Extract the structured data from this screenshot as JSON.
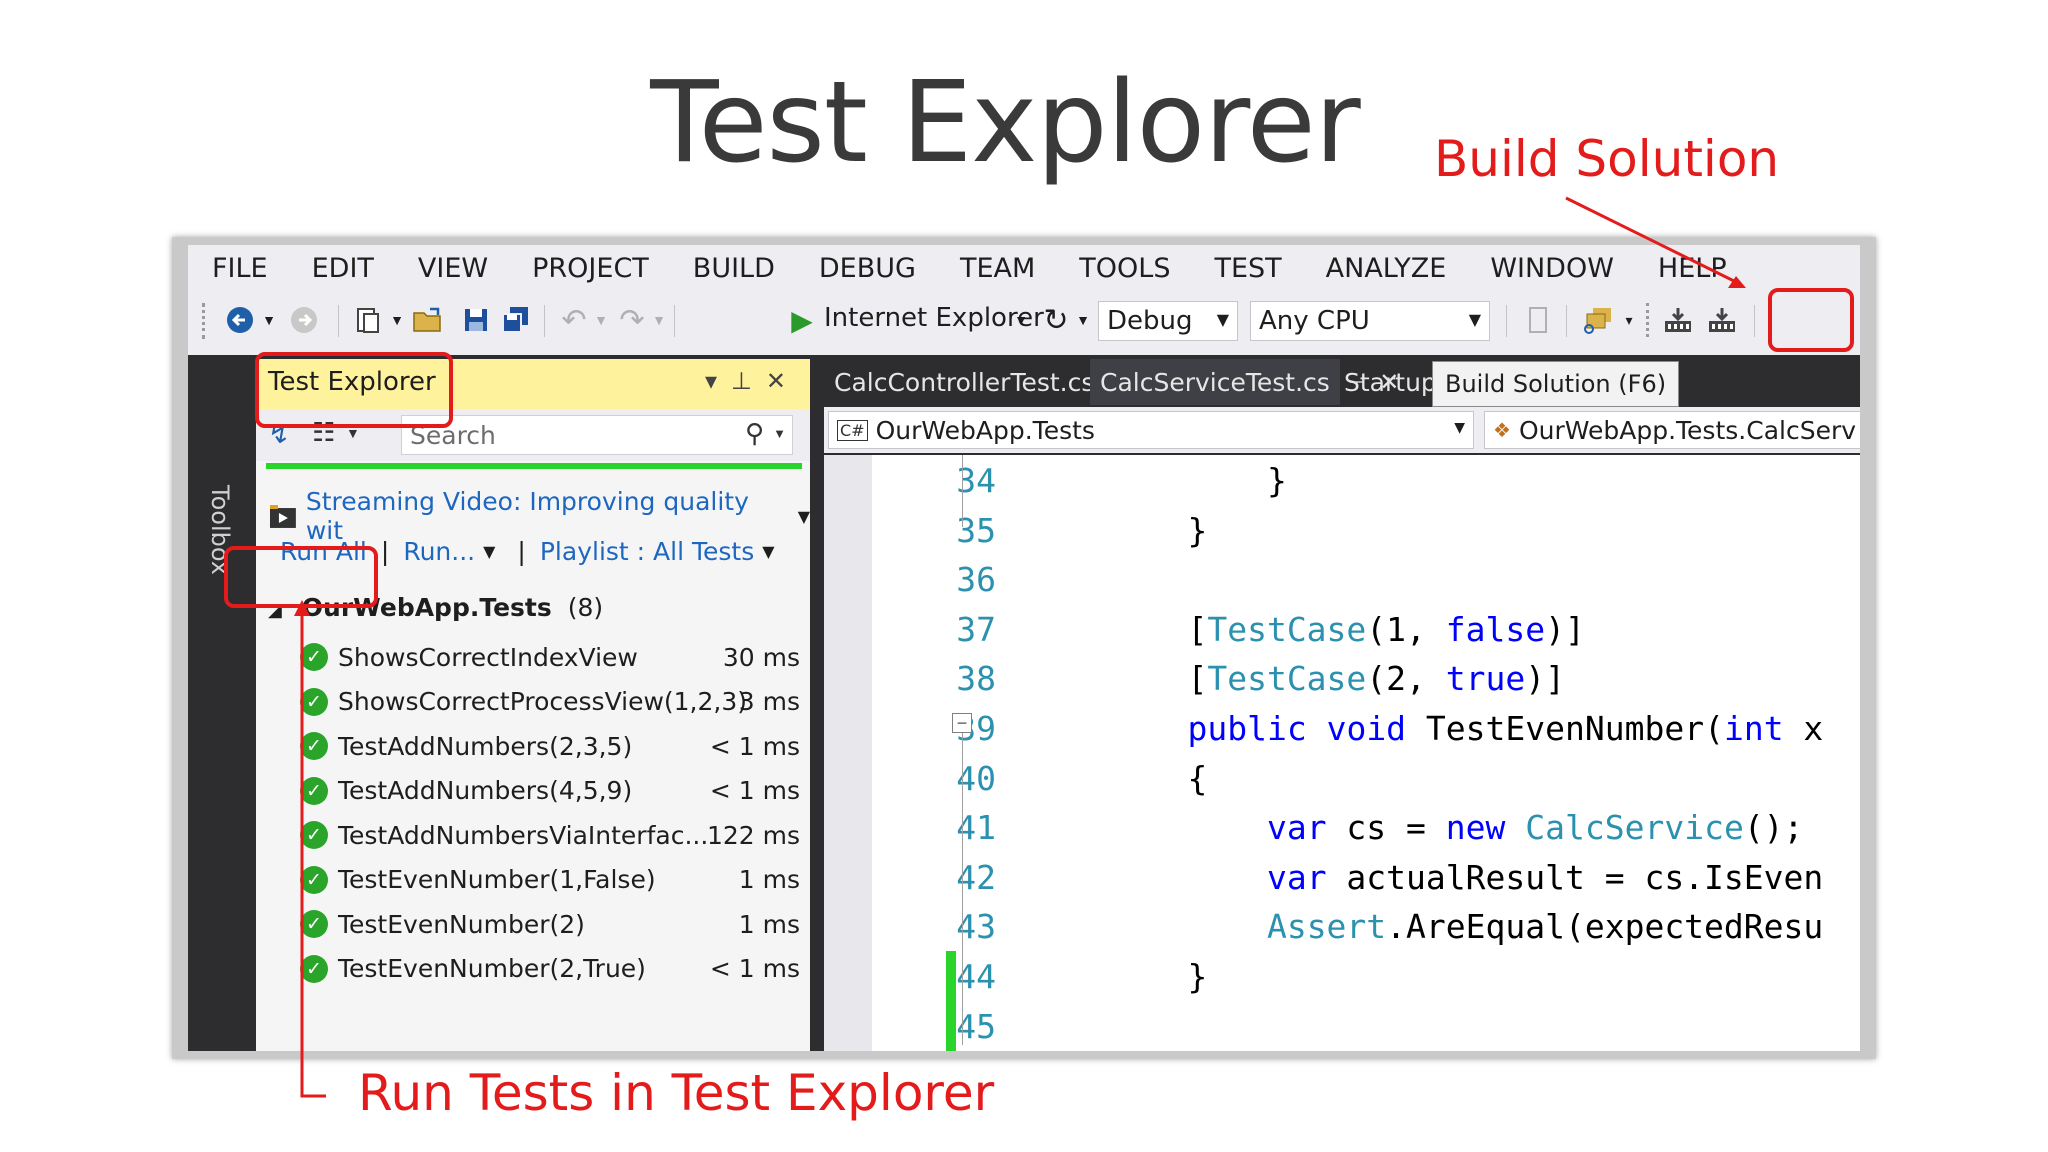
{
  "slide": {
    "title": "Test Explorer",
    "callout_build": "Build Solution",
    "callout_run": "Run Tests in Test Explorer"
  },
  "menu": [
    "FILE",
    "EDIT",
    "VIEW",
    "PROJECT",
    "BUILD",
    "DEBUG",
    "TEAM",
    "TOOLS",
    "TEST",
    "ANALYZE",
    "WINDOW",
    "HELP"
  ],
  "toolbar": {
    "browser": "Internet Explorer",
    "configuration": "Debug",
    "platform": "Any CPU"
  },
  "toolbox": {
    "label": "Toolbox"
  },
  "test_explorer": {
    "title": "Test Explorer",
    "search_placeholder": "Search",
    "streaming": "Streaming Video: Improving quality wit",
    "run_all": "Run All",
    "run": "Run...",
    "playlist": "Playlist : All Tests",
    "group_name": "OurWebApp.Tests",
    "group_count": "(8)",
    "tests": [
      {
        "name": "ShowsCorrectIndexView",
        "duration": "30 ms",
        "status": "passed"
      },
      {
        "name": "ShowsCorrectProcessView(1,2,3)",
        "duration": "3 ms",
        "status": "passed"
      },
      {
        "name": "TestAddNumbers(2,3,5)",
        "duration": "< 1 ms",
        "status": "passed"
      },
      {
        "name": "TestAddNumbers(4,5,9)",
        "duration": "< 1 ms",
        "status": "passed"
      },
      {
        "name": "TestAddNumbersViaInterfac...",
        "duration": "122 ms",
        "status": "passed"
      },
      {
        "name": "TestEvenNumber(1,False)",
        "duration": "1 ms",
        "status": "passed"
      },
      {
        "name": "TestEvenNumber(2)",
        "duration": "1 ms",
        "status": "passed"
      },
      {
        "name": "TestEvenNumber(2,True)",
        "duration": "< 1 ms",
        "status": "passed"
      }
    ]
  },
  "editor": {
    "tabs": [
      "CalcControllerTest.cs",
      "CalcServiceTest.cs",
      "Startup.c"
    ],
    "tooltip": "Build Solution (F6)",
    "nav_left": "OurWebApp.Tests",
    "nav_right": "OurWebApp.Tests.CalcServ",
    "lines": [
      {
        "num": "34",
        "parts": [
          {
            "t": "        }",
            "c": ""
          }
        ]
      },
      {
        "num": "35",
        "parts": [
          {
            "t": "    }",
            "c": ""
          }
        ]
      },
      {
        "num": "36",
        "parts": [
          {
            "t": "",
            "c": ""
          }
        ]
      },
      {
        "num": "37",
        "parts": [
          {
            "t": "    [",
            "c": ""
          },
          {
            "t": "TestCase",
            "c": "ty"
          },
          {
            "t": "(1, ",
            "c": ""
          },
          {
            "t": "false",
            "c": "kw"
          },
          {
            "t": ")]",
            "c": ""
          }
        ]
      },
      {
        "num": "38",
        "parts": [
          {
            "t": "    [",
            "c": ""
          },
          {
            "t": "TestCase",
            "c": "ty"
          },
          {
            "t": "(2, ",
            "c": ""
          },
          {
            "t": "true",
            "c": "kw"
          },
          {
            "t": ")]",
            "c": ""
          }
        ]
      },
      {
        "num": "39",
        "parts": [
          {
            "t": "    ",
            "c": ""
          },
          {
            "t": "public",
            "c": "kw"
          },
          {
            "t": " ",
            "c": ""
          },
          {
            "t": "void",
            "c": "kw"
          },
          {
            "t": " TestEvenNumber(",
            "c": ""
          },
          {
            "t": "int",
            "c": "kw"
          },
          {
            "t": " x",
            "c": ""
          }
        ]
      },
      {
        "num": "40",
        "parts": [
          {
            "t": "    {",
            "c": ""
          }
        ]
      },
      {
        "num": "41",
        "parts": [
          {
            "t": "        ",
            "c": ""
          },
          {
            "t": "var",
            "c": "kw"
          },
          {
            "t": " cs = ",
            "c": ""
          },
          {
            "t": "new",
            "c": "kw"
          },
          {
            "t": " ",
            "c": ""
          },
          {
            "t": "CalcService",
            "c": "ty"
          },
          {
            "t": "();",
            "c": ""
          }
        ]
      },
      {
        "num": "42",
        "parts": [
          {
            "t": "        ",
            "c": ""
          },
          {
            "t": "var",
            "c": "kw"
          },
          {
            "t": " actualResult = cs.IsEven",
            "c": ""
          }
        ]
      },
      {
        "num": "43",
        "parts": [
          {
            "t": "        ",
            "c": ""
          },
          {
            "t": "Assert",
            "c": "ty"
          },
          {
            "t": ".AreEqual(expectedResu",
            "c": ""
          }
        ]
      },
      {
        "num": "44",
        "parts": [
          {
            "t": "    }",
            "c": ""
          }
        ]
      },
      {
        "num": "45",
        "parts": [
          {
            "t": "",
            "c": ""
          }
        ]
      }
    ]
  },
  "colors": {
    "annotation": "#e31b1b",
    "pass": "#2aa52a",
    "keyword": "#0000ff",
    "type": "#2b91af"
  }
}
